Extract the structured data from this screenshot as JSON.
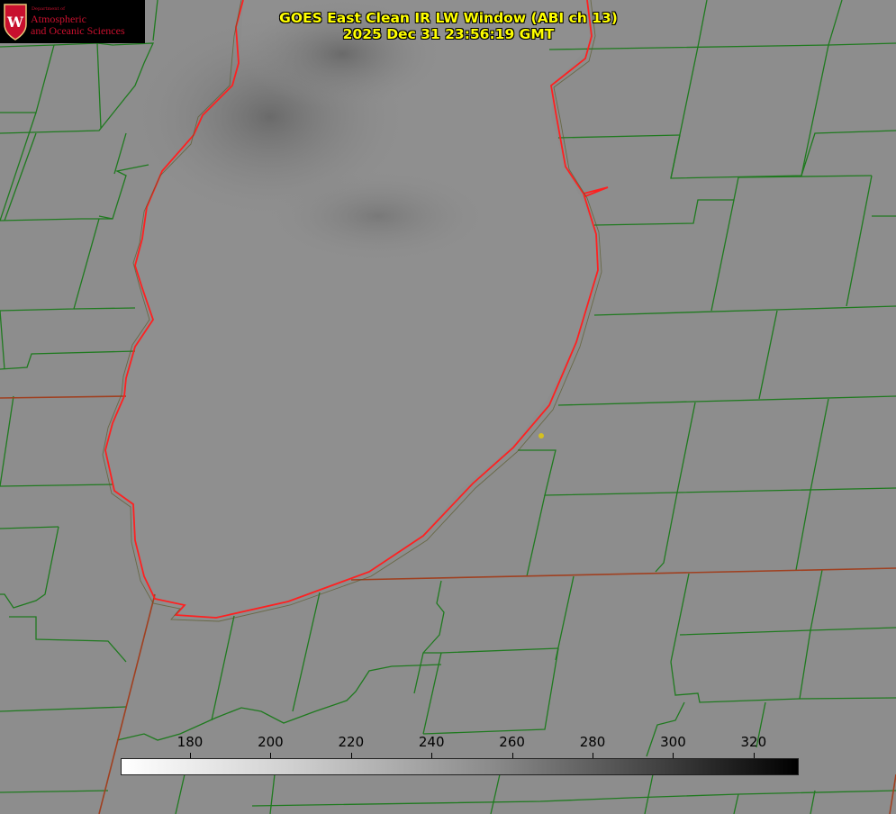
{
  "header": {
    "title_line1": "GOES East Clean IR LW Window (ABI ch 13)",
    "title_line2": "2025 Dec 31 23:56:19 GMT"
  },
  "logo": {
    "department": "Department of",
    "line1": "Atmospheric",
    "line2": "and Oceanic Sciences",
    "crest_icon": "uw-crest-icon",
    "color": "#c8102e"
  },
  "colorbar": {
    "ticks": [
      "180",
      "200",
      "220",
      "240",
      "260",
      "280",
      "300",
      "320"
    ],
    "tick_values": [
      180,
      200,
      220,
      240,
      260,
      280,
      300,
      320
    ],
    "range": [
      163,
      331
    ],
    "colormap": "white-to-black"
  },
  "colors": {
    "title": "#ffff00",
    "county_lines": "#1f7a1f",
    "state_lines": "#a04020",
    "shoreline": "#ff2020",
    "marker": "#d4c020"
  }
}
